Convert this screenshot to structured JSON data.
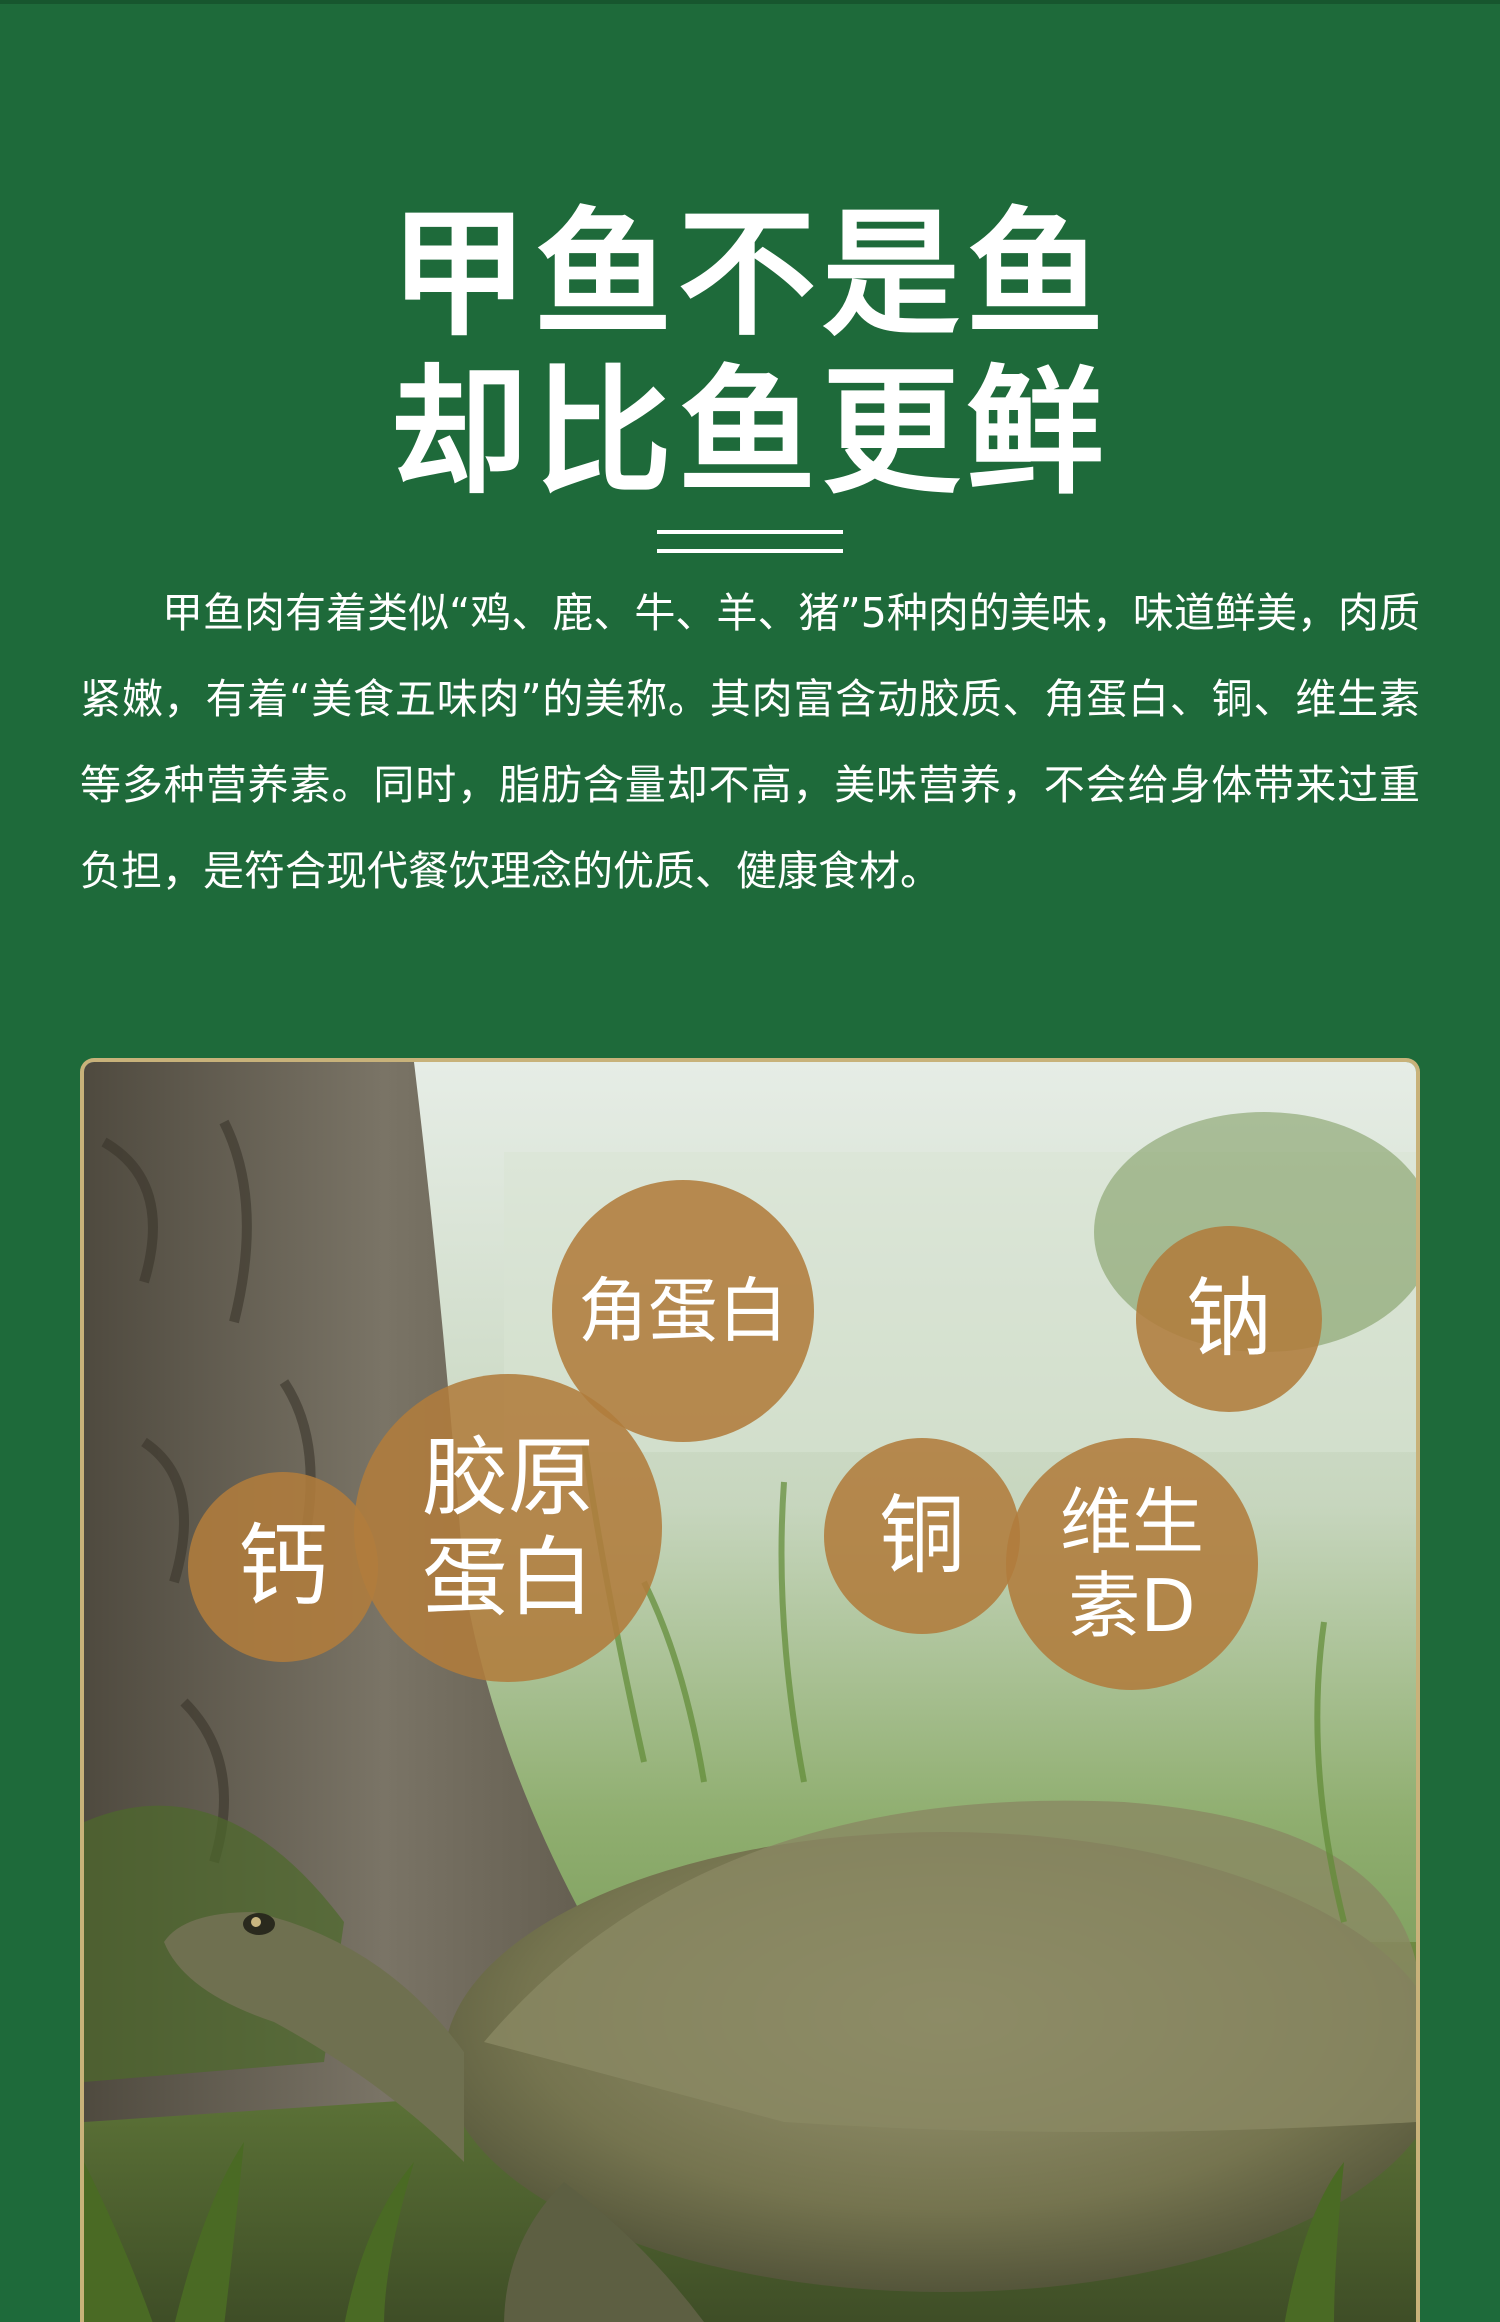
{
  "headline": {
    "line1": "甲鱼不是鱼",
    "line2": "却比鱼更鲜"
  },
  "intro_text": "甲鱼肉有着类似“鸡、鹿、牛、羊、猪”5种肉的美味，味道鲜美，肉质紧嫩，有着“美食五味肉”的美称。其肉富含动胶质、角蛋白、铜、维生素等多种营养素。同时，脂肪含量却不高，美味营养，不会给身体带来过重负担，是符合现代餐饮理念的优质、健康食材。",
  "nutrient_bubbles": [
    {
      "label": "角蛋白"
    },
    {
      "label": "钠"
    },
    {
      "label": "钙"
    },
    {
      "label": "胶原\n蛋白"
    },
    {
      "label": "铜"
    },
    {
      "label": "维生\n素D"
    }
  ],
  "colors": {
    "background": "#1e6a3a",
    "frame_border": "#c8b27a",
    "bubble_fill": "#b07c3c"
  }
}
